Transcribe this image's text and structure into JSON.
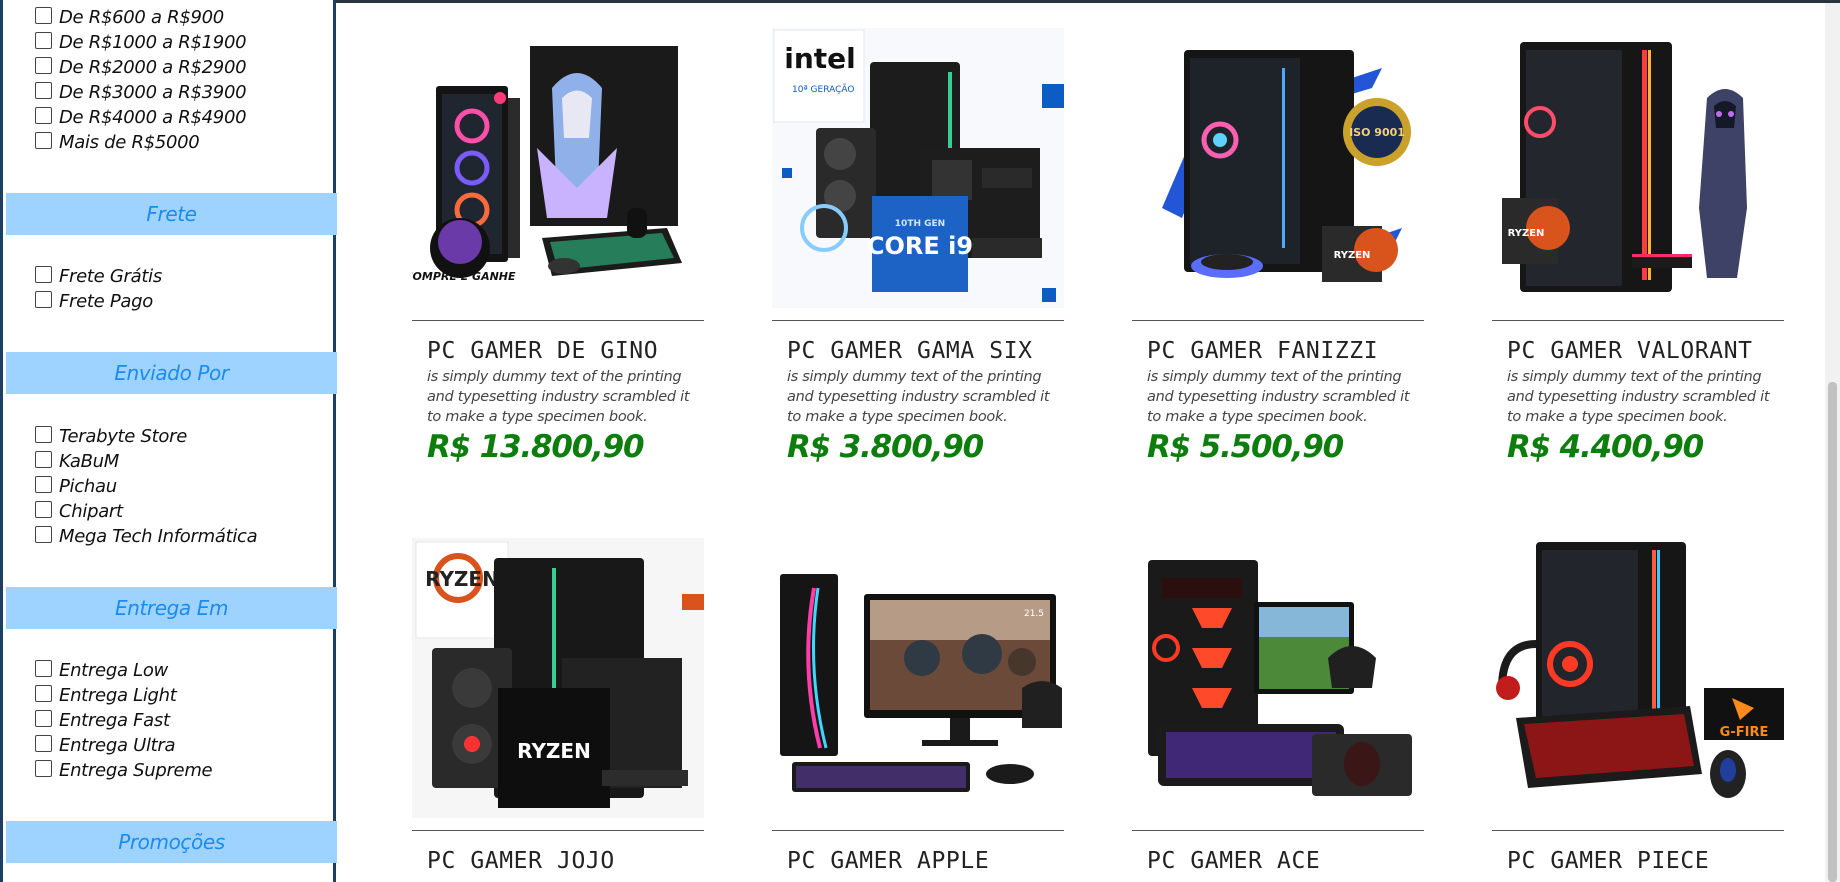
{
  "filters": {
    "price_options": [
      "De R$600 a R$900",
      "De R$1000 a R$1900",
      "De R$2000 a R$2900",
      "De R$3000 a R$3900",
      "De R$4000 a R$4900",
      "Mais de R$5000"
    ],
    "frete": {
      "title": "Frete",
      "options": [
        "Frete Grátis",
        "Frete Pago"
      ]
    },
    "enviado": {
      "title": "Enviado Por",
      "options": [
        "Terabyte Store",
        "KaBuM",
        "Pichau",
        "Chipart",
        "Mega Tech Informática"
      ]
    },
    "entrega": {
      "title": "Entrega Em",
      "options": [
        "Entrega Low",
        "Entrega Light",
        "Entrega Fast",
        "Entrega Ultra",
        "Entrega Supreme"
      ]
    },
    "promocoes": {
      "title": "Promoções"
    }
  },
  "products": [
    {
      "name": "PC GAMER DE GINO",
      "desc": "is simply dummy text of the printing and typesetting industry scrambled it to make a type specimen book.",
      "price": "R$ 13.800,90",
      "badge": "COMPRE E GANHE"
    },
    {
      "name": "PC GAMER GAMA SIX",
      "desc": "is simply dummy text of the printing and typesetting industry scrambled it to make a type specimen book.",
      "price": "R$ 3.800,90",
      "brand": "intel",
      "brand_sub": "10ª GERAÇÃO",
      "chip_top": "10TH GEN",
      "chip": "CORE i9"
    },
    {
      "name": "PC GAMER FANIZZI",
      "desc": "is simply dummy text of the printing and typesetting industry scrambled it to make a type specimen book.",
      "price": "R$ 5.500,90",
      "seal": "ISO 9001",
      "cpu": "RYZEN"
    },
    {
      "name": "PC GAMER VALORANT",
      "desc": "is simply dummy text of the printing and typesetting industry scrambled it to make a type specimen book.",
      "price": "R$ 4.400,90",
      "cpu": "RYZEN"
    },
    {
      "name": "PC GAMER JOJO",
      "brand": "RYZEN",
      "cpu": "RYZEN"
    },
    {
      "name": "PC GAMER APPLE",
      "size": "21.5"
    },
    {
      "name": "PC GAMER ACE"
    },
    {
      "name": "PC GAMER PIECE",
      "brand": "G-FIRE"
    }
  ]
}
